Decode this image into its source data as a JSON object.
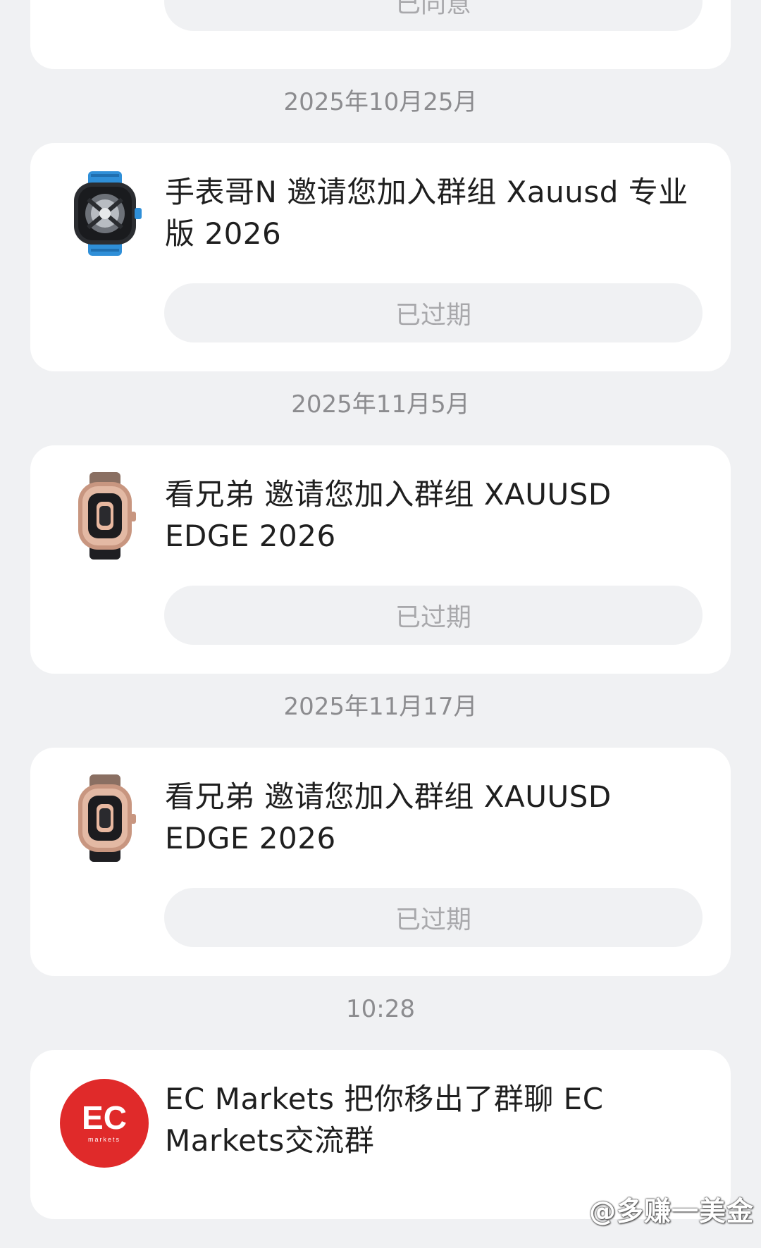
{
  "top_card": {
    "button_label": "已同意"
  },
  "messages": [
    {
      "date": "2025年10月25月",
      "text": "手表哥N 邀请您加入群组 Xauusd 专业版 2026",
      "button_label": "已过期",
      "avatar_icon": "blue-skeleton-watch-avatar"
    },
    {
      "date": "2025年11月5月",
      "text": "看兄弟 邀请您加入群组 XAUUSD EDGE 2026",
      "button_label": "已过期",
      "avatar_icon": "rose-gold-watch-avatar"
    },
    {
      "date": "2025年11月17月",
      "text": "看兄弟 邀请您加入群组 XAUUSD EDGE 2026",
      "button_label": "已过期",
      "avatar_icon": "rose-gold-watch-avatar"
    },
    {
      "date": "10:28",
      "text": "EC Markets 把你移出了群聊 EC Markets交流群",
      "avatar_icon": "ec-markets-logo-avatar",
      "avatar_logo_text": "EC",
      "avatar_logo_subtext": "markets"
    }
  ],
  "watermark": "@多赚一美金",
  "colors": {
    "background": "#f0f1f3",
    "card": "#ffffff",
    "button_text": "#a8a8ab",
    "ec_logo_red": "#e02a2a"
  }
}
